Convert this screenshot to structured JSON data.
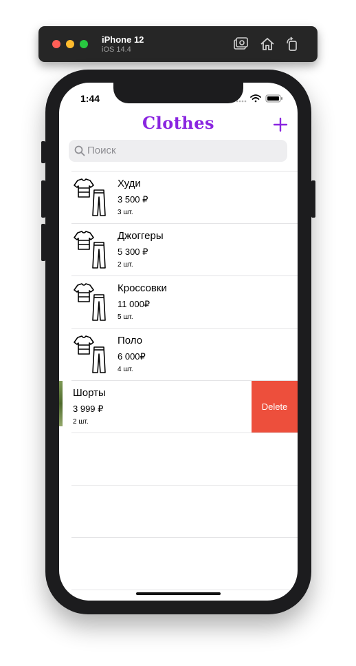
{
  "simulator": {
    "device_name": "iPhone 12",
    "os_version": "iOS 14.4",
    "buttons": [
      "screenshot-icon",
      "home-icon",
      "rotate-icon"
    ],
    "traffic_lights": [
      "#ff5f57",
      "#febc2e",
      "#28c840"
    ]
  },
  "status_bar": {
    "time": "1:44",
    "icons": [
      "signal-icon",
      "wifi-icon",
      "battery-icon"
    ]
  },
  "nav": {
    "title": "Clothes",
    "add_icon": "plus-icon",
    "accent": "#8a25e0"
  },
  "search": {
    "placeholder": "Поиск",
    "icon": "magnifier-icon"
  },
  "items": [
    {
      "name": "Худи",
      "price": "3 500 ₽",
      "quantity": "3 шт.",
      "icon": "clothes-outline-icon"
    },
    {
      "name": "Джоггеры",
      "price": "5 300 ₽",
      "quantity": "2 шт.",
      "icon": "clothes-outline-icon"
    },
    {
      "name": "Кроссовки",
      "price": "11 000₽",
      "quantity": "5 шт.",
      "icon": "clothes-outline-icon"
    },
    {
      "name": "Поло",
      "price": "6 000₽",
      "quantity": "4 шт.",
      "icon": "clothes-outline-icon"
    },
    {
      "name": "Шорты",
      "price": "3 999 ₽",
      "quantity": "2 шт.",
      "icon": "photo-thumbnail",
      "swiped": true,
      "action": "Delete",
      "action_color": "#ed4f3c"
    }
  ]
}
